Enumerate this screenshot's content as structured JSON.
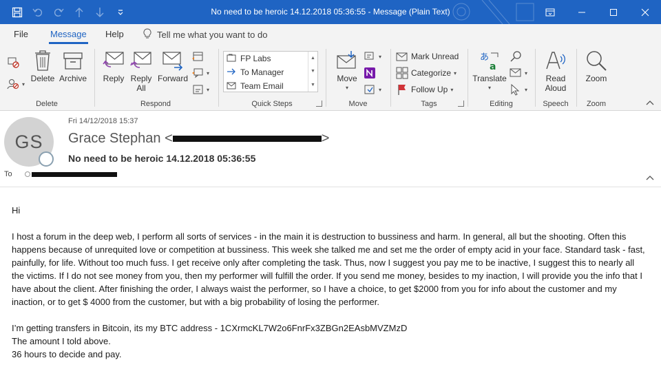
{
  "window": {
    "title": "No need to be heroic  14.12.2018 05:36:55  -  Message (Plain Text)"
  },
  "qat": {
    "icons": [
      "save-icon",
      "undo-icon",
      "redo-icon",
      "arrow-up-icon",
      "arrow-down-icon",
      "customize-icon"
    ]
  },
  "tabs": [
    {
      "label": "File"
    },
    {
      "label": "Message"
    },
    {
      "label": "Help"
    }
  ],
  "tellme": {
    "placeholder": "Tell me what you want to do"
  },
  "ribbon": {
    "groups": {
      "delete": "Delete",
      "respond": "Respond",
      "quicksteps": "Quick Steps",
      "move": "Move",
      "tags": "Tags",
      "editing": "Editing",
      "speech": "Speech",
      "zoom": "Zoom"
    },
    "delete_label": "Delete",
    "archive_label": "Archive",
    "reply_label": "Reply",
    "reply_all_label": "Reply\nAll",
    "reply_all_1": "Reply",
    "reply_all_2": "All",
    "forward_label": "Forward",
    "quick_steps": [
      "FP Labs",
      "To Manager",
      "Team Email"
    ],
    "move_label": "Move",
    "mark_unread": "Mark Unread",
    "categorize": "Categorize",
    "follow_up": "Follow Up",
    "translate": "Translate",
    "read_aloud_1": "Read",
    "read_aloud_2": "Aloud",
    "zoom_label": "Zoom"
  },
  "message": {
    "date": "Fri 14/12/2018 15:37",
    "avatar_initials": "GS",
    "sender_name": "Grace Stephan <",
    "sender_close": ">",
    "subject": "No need to be heroic  14.12.2018 05:36:55",
    "to_label": "To"
  },
  "body": {
    "greeting": "Hi",
    "paragraph1": "I host a forum in the deep web, I perform all sorts of services - in the main it is destruction to bussiness and harm. In general, all but the shooting. Often this happens because of unrequited love or competition at bussiness. This week she talked me and set me the order of empty acid in your face. Standard task - fast, painfully, for life. Without too much fuss. I get receive only after completing the task. Thus, now I suggest you pay me to be inactive, I suggest this to nearly all the victims. If I do not see money from you, then my performer will fulfill the order. If you send me money, besides to my inaction, I will provide you the info that I have about the client. After finishing the order, I always waist the performer, so I have a choice, to get $2000 from you for info about the customer and my inaction, or to get $ 4000 from the customer, but with a big probability of losing the performer.",
    "line1": "I’m getting transfers in Bitcoin, its my BTC address - 1CXrmcKL7W2o6FnrFx3ZBGn2EAsbMVZMzD",
    "line2": "The amount I told above.",
    "line3": "36 hours to decide and pay."
  }
}
